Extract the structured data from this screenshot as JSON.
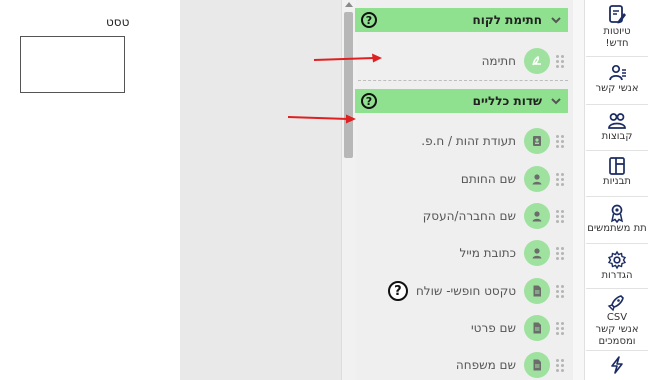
{
  "canvas": {
    "label": "טסט"
  },
  "palette": {
    "sections": [
      {
        "title": "חתימת לקוח",
        "help": "?",
        "items": [
          {
            "label": "חתימה",
            "icon": "signature-icon"
          }
        ]
      },
      {
        "title": "שדות כלליים",
        "help": "?",
        "items": [
          {
            "label": "תעודת זהות / ח.פ.",
            "icon": "id-card-icon"
          },
          {
            "label": "שם החותם",
            "icon": "person-icon"
          },
          {
            "label": "שם החברה/העסק",
            "icon": "person-icon"
          },
          {
            "label": "כתובת מייל",
            "icon": "person-icon"
          },
          {
            "label": "טקסט חופשי- שולח",
            "icon": "document-icon",
            "help": "?"
          },
          {
            "label": "שם פרטי",
            "icon": "document-icon"
          },
          {
            "label": "שם משפחה",
            "icon": "document-icon"
          }
        ]
      }
    ]
  },
  "sidebar": {
    "items": [
      {
        "label1": "טיוטות",
        "label2": "חדש!",
        "icon": "drafts-icon"
      },
      {
        "label1": "אנשי קשר",
        "icon": "contacts-icon"
      },
      {
        "label1": "קבוצות",
        "icon": "groups-icon"
      },
      {
        "label1": "תבניות",
        "icon": "templates-icon"
      },
      {
        "label1": "תת משתמשים",
        "icon": "sub-users-icon"
      },
      {
        "label1": "הגדרות",
        "icon": "settings-icon"
      },
      {
        "label1": "CSV",
        "label2": "אנשי קשר",
        "label3": "ומסמכים",
        "icon": "csv-rocket-icon"
      },
      {
        "label1": "",
        "icon": "lightning-icon"
      }
    ]
  },
  "colors": {
    "accent_green": "#8fe08f",
    "icon_green": "#9fe19f",
    "arrow_red": "#e02020"
  }
}
